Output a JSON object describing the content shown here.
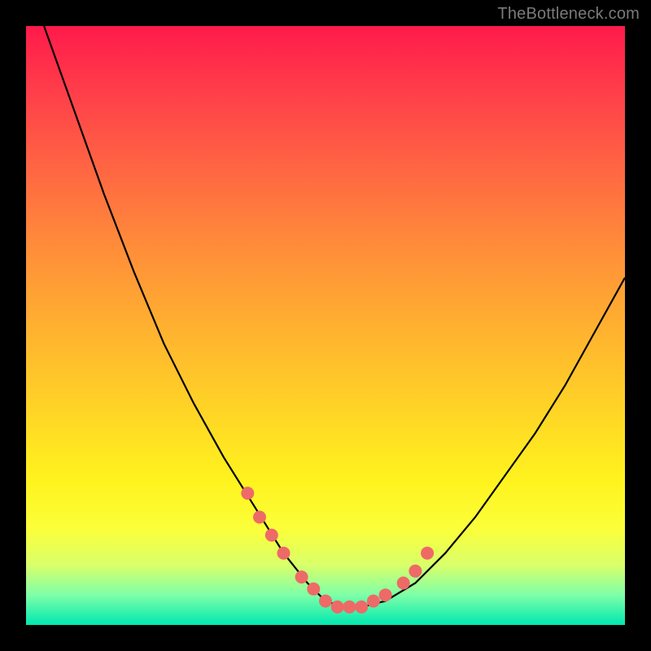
{
  "watermark": {
    "text": "TheBottleneck.com"
  },
  "colors": {
    "black": "#000000",
    "curve": "#000000",
    "dots": "#ee6a66"
  },
  "chart_data": {
    "type": "line",
    "title": "",
    "xlabel": "",
    "ylabel": "",
    "xlim": [
      0,
      100
    ],
    "ylim": [
      0,
      100
    ],
    "series": [
      {
        "name": "bottleneck-curve",
        "x": [
          3,
          8,
          13,
          18,
          23,
          28,
          33,
          38,
          43,
          47,
          50,
          53,
          56,
          60,
          65,
          70,
          75,
          80,
          85,
          90,
          95,
          100
        ],
        "y": [
          100,
          86,
          72,
          59,
          47,
          37,
          28,
          20,
          12,
          7,
          4,
          3,
          3,
          4,
          7,
          12,
          18,
          25,
          32,
          40,
          49,
          58
        ]
      }
    ],
    "highlight_points": {
      "name": "highlight-dots",
      "x": [
        37,
        39,
        41,
        43,
        46,
        48,
        50,
        52,
        54,
        56,
        58,
        60,
        63,
        65,
        67
      ],
      "y": [
        22,
        18,
        15,
        12,
        8,
        6,
        4,
        3,
        3,
        3,
        4,
        5,
        7,
        9,
        12
      ]
    }
  }
}
